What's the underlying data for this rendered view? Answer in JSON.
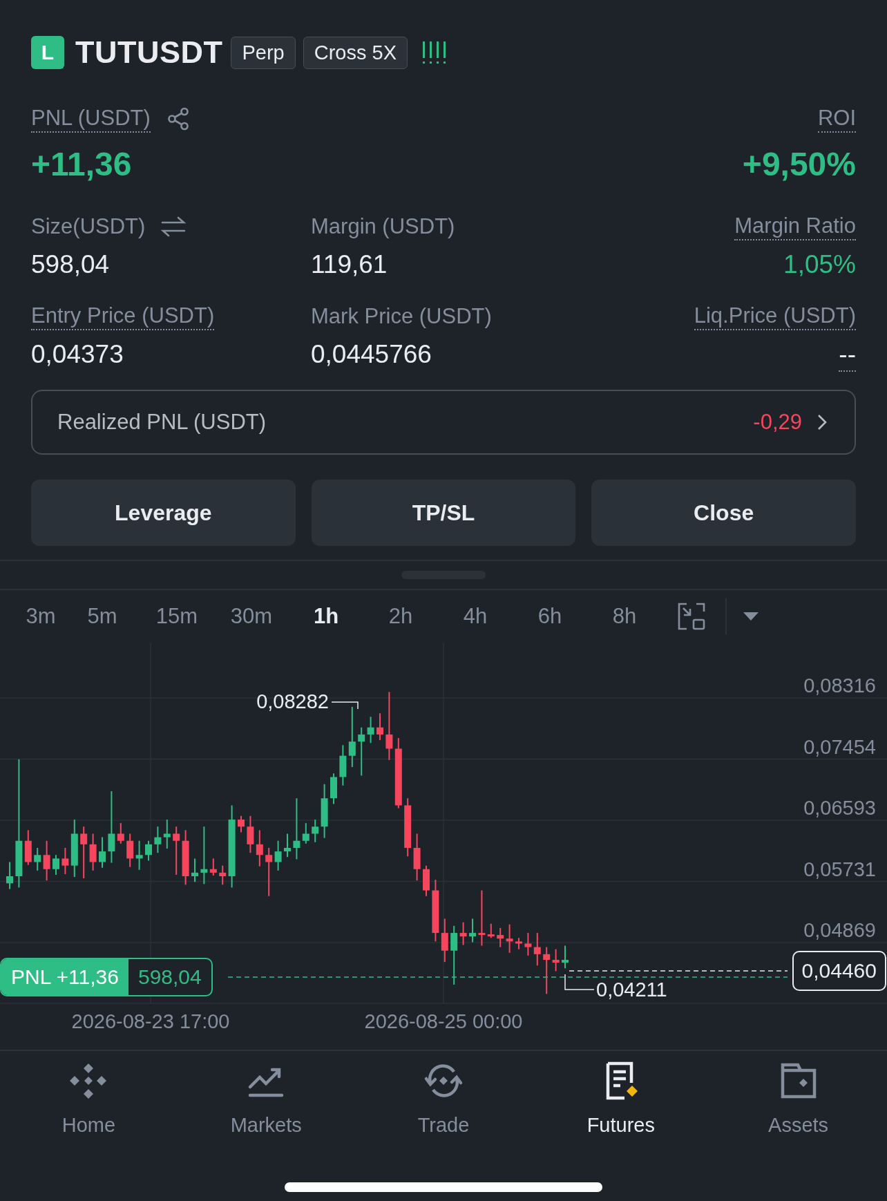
{
  "header": {
    "side_badge": "L",
    "symbol": "TUTUSDT",
    "tags": [
      "Perp",
      "Cross 5X"
    ]
  },
  "pnl": {
    "label": "PNL (USDT)",
    "value": "+11,36"
  },
  "roi": {
    "label": "ROI",
    "value": "+9,50%"
  },
  "stats": [
    {
      "label": "Size(USDT)",
      "value": "598,04",
      "kind": "swap",
      "label_dotted": false,
      "value_dotted": false,
      "color": "#eaecef"
    },
    {
      "label": "Margin (USDT)",
      "value": "119,61",
      "kind": "plain",
      "label_dotted": false,
      "value_dotted": false,
      "color": "#eaecef"
    },
    {
      "label": "Margin Ratio",
      "value": "1,05%",
      "kind": "plain",
      "label_dotted": true,
      "value_dotted": false,
      "color": "#2ebd85"
    },
    {
      "label": "Entry Price (USDT)",
      "value": "0,04373",
      "kind": "plain",
      "label_dotted": true,
      "value_dotted": false,
      "color": "#eaecef"
    },
    {
      "label": "Mark Price (USDT)",
      "value": "0,0445766",
      "kind": "plain",
      "label_dotted": false,
      "value_dotted": false,
      "color": "#eaecef"
    },
    {
      "label": "Liq.Price (USDT)",
      "value": "--",
      "kind": "plain",
      "label_dotted": true,
      "value_dotted": true,
      "color": "#eaecef"
    }
  ],
  "realized_pnl": {
    "label": "Realized PNL (USDT)",
    "value": "-0,29"
  },
  "actions": [
    "Leverage",
    "TP/SL",
    "Close"
  ],
  "timeframes": [
    {
      "label": "3m",
      "selected": false
    },
    {
      "label": "5m",
      "selected": false
    },
    {
      "label": "15m",
      "selected": false
    },
    {
      "label": "30m",
      "selected": false
    },
    {
      "label": "1h",
      "selected": true
    },
    {
      "label": "2h",
      "selected": false
    },
    {
      "label": "4h",
      "selected": false
    },
    {
      "label": "6h",
      "selected": false
    },
    {
      "label": "8h",
      "selected": false
    }
  ],
  "chart": {
    "price_labels": [
      "0,08316",
      "0,07454",
      "0,06593",
      "0,05731",
      "0,04869"
    ],
    "high_label": "0,08282",
    "low_label": "0,04211",
    "current_price": "0,04460",
    "position": {
      "pnl": "PNL +11,36",
      "size": "598,04"
    },
    "dates": [
      "2026-08-23 17:00",
      "2026-08-25 00:00"
    ]
  },
  "nav": [
    {
      "label": "Home",
      "kind": "home",
      "selected": false
    },
    {
      "label": "Markets",
      "kind": "markets",
      "selected": false
    },
    {
      "label": "Trade",
      "kind": "trade",
      "selected": false
    },
    {
      "label": "Futures",
      "kind": "futures",
      "selected": true
    },
    {
      "label": "Assets",
      "kind": "assets",
      "selected": false
    }
  ]
}
